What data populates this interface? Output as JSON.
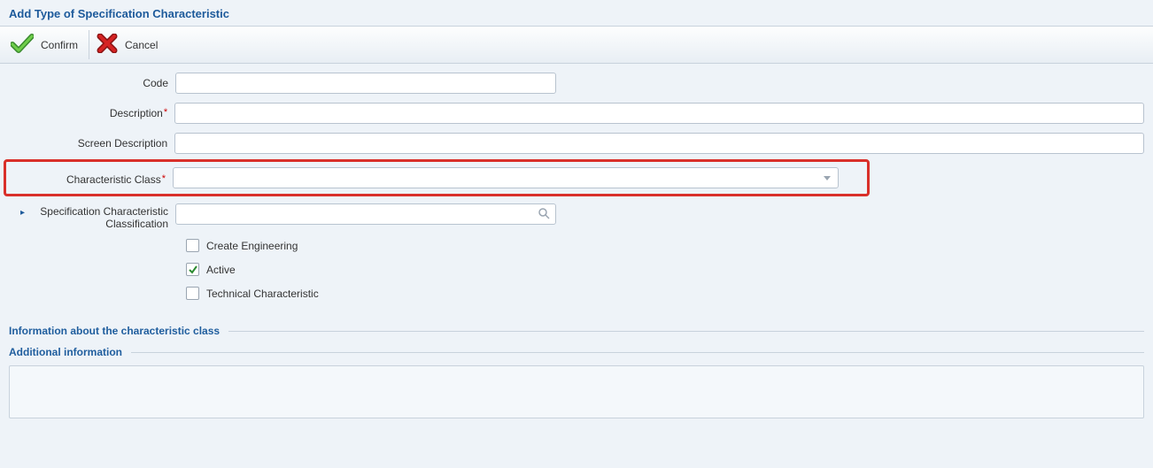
{
  "title": "Add Type of Specification Characteristic",
  "toolbar": {
    "confirm": "Confirm",
    "cancel": "Cancel"
  },
  "form": {
    "code_label": "Code",
    "code_value": "",
    "description_label": "Description",
    "description_value": "",
    "screen_description_label": "Screen Description",
    "screen_description_value": "",
    "char_class_label": "Characteristic Class",
    "char_class_value": "",
    "spec_char_class_label": "Specification Characteristic Classification",
    "spec_char_class_value": "",
    "create_engineering_label": "Create Engineering",
    "create_engineering_checked": false,
    "active_label": "Active",
    "active_checked": true,
    "technical_char_label": "Technical Characteristic",
    "technical_char_checked": false
  },
  "sections": {
    "info_class": "Information about the characteristic class",
    "additional": "Additional information"
  }
}
